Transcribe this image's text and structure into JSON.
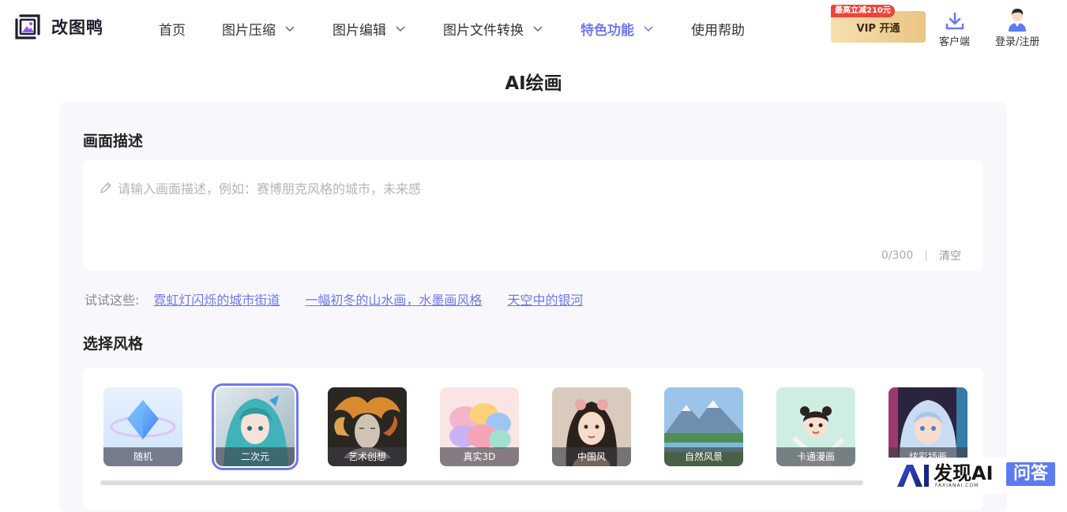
{
  "brand": {
    "name": "改图鸭",
    "accent": "#6e78f0"
  },
  "nav": {
    "items": [
      {
        "label": "首页",
        "dropdown": false
      },
      {
        "label": "图片压缩",
        "dropdown": true
      },
      {
        "label": "图片编辑",
        "dropdown": true
      },
      {
        "label": "图片文件转换",
        "dropdown": true
      },
      {
        "label": "特色功能",
        "dropdown": true,
        "active": true
      },
      {
        "label": "使用帮助",
        "dropdown": false
      }
    ]
  },
  "header": {
    "vip_tag": "最高立减210元",
    "vip_label": "VIP 开通",
    "client_label": "客户端",
    "login_label": "登录/注册"
  },
  "page": {
    "title": "AI绘画"
  },
  "description": {
    "section_label": "画面描述",
    "placeholder": "请输入画面描述，例如：赛博朋克风格的城市，未来感",
    "counter": "0/300",
    "separator": "|",
    "clear_label": "清空"
  },
  "suggestions": {
    "label": "试试这些:",
    "items": [
      "霓虹灯闪烁的城市街道",
      "一幅初冬的山水画，水墨画风格",
      "天空中的银河"
    ]
  },
  "styles": {
    "section_label": "选择风格",
    "selected_index": 1,
    "items": [
      {
        "label": "随机",
        "icon": "random-crystal"
      },
      {
        "label": "二次元",
        "icon": "anime-girl"
      },
      {
        "label": "艺术创想",
        "icon": "art-sculpture"
      },
      {
        "label": "真实3D",
        "icon": "3d-sofa"
      },
      {
        "label": "中国风",
        "icon": "chinese-lady"
      },
      {
        "label": "自然风景",
        "icon": "mountain-lake"
      },
      {
        "label": "卡通漫画",
        "icon": "cartoon-girl"
      },
      {
        "label": "炫彩插画",
        "icon": "colorful-portrait"
      }
    ]
  },
  "watermark": {
    "text": "发现AI",
    "subtext": "FAXIANAI.COM",
    "badge": "问答"
  }
}
